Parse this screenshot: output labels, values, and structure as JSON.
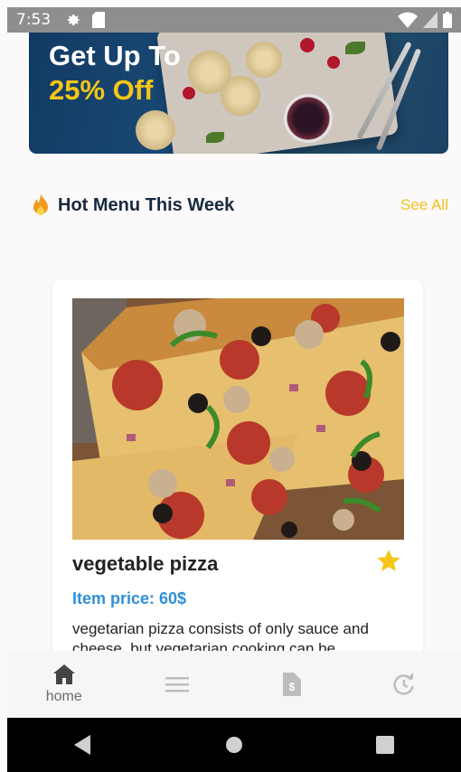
{
  "status_bar": {
    "time": "7:53"
  },
  "banner": {
    "title": "Get Up To",
    "subtitle": "25% Off"
  },
  "section": {
    "title": "Hot Menu This Week",
    "see_all": "See All"
  },
  "card": {
    "name": "vegetable pizza",
    "price": "Item price: 60$",
    "description": "vegetarian pizza consists of only sauce and cheese, but vegetarian cooking can be"
  },
  "bottom_nav": {
    "items": [
      {
        "label": "home",
        "icon": "home-icon"
      },
      {
        "label": "",
        "icon": "menu-icon"
      },
      {
        "label": "",
        "icon": "invoice-icon"
      },
      {
        "label": "",
        "icon": "history-icon"
      }
    ]
  },
  "colors": {
    "accent_yellow": "#f2c21a",
    "price_blue": "#2f8fd6",
    "heading": "#17293f"
  }
}
